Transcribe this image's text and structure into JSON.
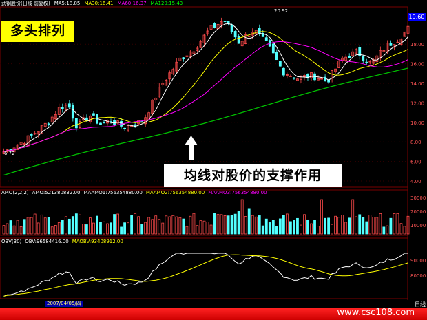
{
  "header": {
    "stock": "武钢股份(日线 前复权)",
    "ma5": "MA5:18.85",
    "ma30": "MA30:16.41",
    "ma60": "MA60:16.37",
    "ma120": "MA120:15.43"
  },
  "labels": {
    "bull_alignment": "多头排列",
    "ma_support": "均线对股价的支撑作用",
    "current_price": "19.60",
    "high_marker": "20.92",
    "low_marker": "6.72",
    "date": "2007/04/05/四",
    "period": "日线",
    "brand": "www.csc108.com"
  },
  "price_axis": [
    "18.00",
    "16.00",
    "14.00",
    "12.00",
    "10.00",
    "8.00",
    "6.00",
    "4.00"
  ],
  "volume_header": {
    "name": "AMO(2,2,2)",
    "amo": "AMO:521380832.00",
    "maamo1": "MAAMO1:756354880.00",
    "maamo2": "MAAMO2:756354880.00",
    "maamo3": "MAAMO3:756354880.00"
  },
  "volume_axis": [
    "30000",
    "20000",
    "10000"
  ],
  "obv_header": {
    "name": "OBV(30)",
    "obv": "OBV:96584416.00",
    "maobv": "MAOBV:93408912.00"
  },
  "obv_axis": [
    "90000",
    "80000"
  ],
  "colors": {
    "up": "#ff4b4b",
    "down": "#53ffff",
    "ma5": "#ffffff",
    "ma30": "#ffff00",
    "ma60": "#ff00ff",
    "ma120": "#00c000"
  }
}
